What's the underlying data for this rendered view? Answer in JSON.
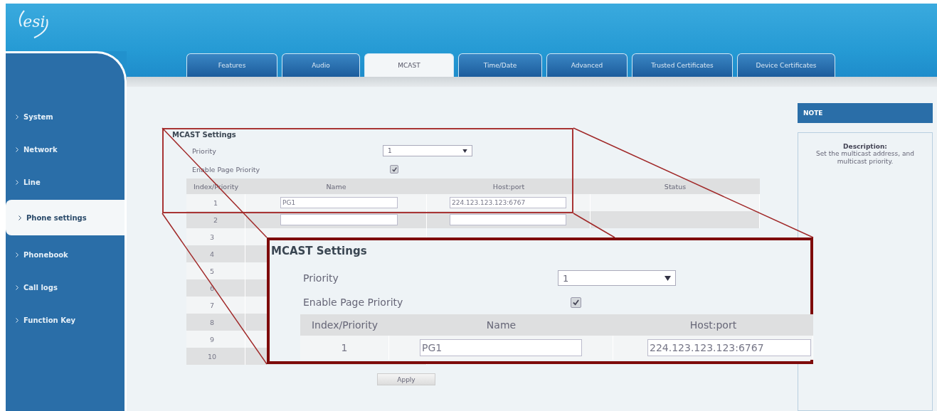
{
  "logo": {
    "text": "esi"
  },
  "sidebar": {
    "items": [
      {
        "label": "System",
        "selected": false
      },
      {
        "label": "Network",
        "selected": false
      },
      {
        "label": "Line",
        "selected": false
      },
      {
        "label": "Phone settings",
        "selected": true
      },
      {
        "label": "Phonebook",
        "selected": false
      },
      {
        "label": "Call logs",
        "selected": false
      },
      {
        "label": "Function Key",
        "selected": false
      }
    ]
  },
  "tabs": [
    {
      "label": "Features",
      "selected": false
    },
    {
      "label": "Audio",
      "selected": false
    },
    {
      "label": "MCAST",
      "selected": true
    },
    {
      "label": "Time/Date",
      "selected": false
    },
    {
      "label": "Advanced",
      "selected": false
    },
    {
      "label": "Trusted Certificates",
      "selected": false
    },
    {
      "label": "Device Certificates",
      "selected": false
    }
  ],
  "settings": {
    "title": "MCAST Settings",
    "priority": {
      "label": "Priority",
      "value": "1"
    },
    "enable_page_priority": {
      "label": "Enable Page Priority",
      "checked": true
    },
    "table": {
      "columns": [
        "Index/Priority",
        "Name",
        "Host:port",
        "Status"
      ],
      "rows": [
        {
          "kind": "entry",
          "index": "1",
          "name": "PG1",
          "host": "224.123.123.123:6767"
        },
        {
          "kind": "entry",
          "index": "2"
        },
        {
          "kind": "covered",
          "index": "3"
        },
        {
          "kind": "covered",
          "index": "4"
        },
        {
          "kind": "covered",
          "index": "5"
        },
        {
          "kind": "covered",
          "index": "6"
        },
        {
          "kind": "covered",
          "index": "7"
        },
        {
          "kind": "covered",
          "index": "8"
        },
        {
          "kind": "covered",
          "index": "9"
        },
        {
          "kind": "covered",
          "index": "10"
        }
      ]
    },
    "apply": "Apply"
  },
  "magnifier": {
    "title": "MCAST Settings",
    "priority": {
      "label": "Priority",
      "value": "1"
    },
    "enable_page_priority": {
      "label": "Enable Page Priority",
      "checked": true
    },
    "columns": [
      "Index/Priority",
      "Name",
      "Host:port"
    ],
    "row": {
      "index": "1",
      "name": "PG1",
      "host": "224.123.123.123:6767"
    }
  },
  "note": {
    "title": "NOTE",
    "heading": "Description:",
    "text": "Set the multicast address, and multicast priority."
  }
}
